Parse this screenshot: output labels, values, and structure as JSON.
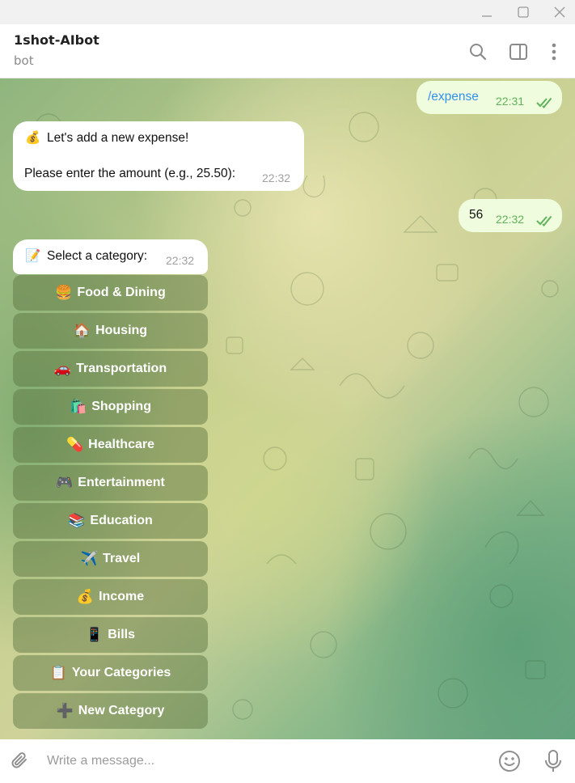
{
  "window": {
    "minimize_icon": "minimize-icon",
    "maximize_icon": "maximize-icon",
    "close_icon": "close-icon"
  },
  "header": {
    "title": "1shot-AIbot",
    "status": "bot",
    "icons": [
      "search-icon",
      "sidebar-toggle-icon",
      "more-vertical-icon"
    ]
  },
  "messages": [
    {
      "direction": "outgoing",
      "text": "/expense",
      "time": "22:31",
      "read": true
    },
    {
      "direction": "incoming",
      "line1_emoji": "💰",
      "line1": "Let's add a new expense!",
      "line2": "Please enter the amount (e.g., 25.50):",
      "time": "22:32"
    },
    {
      "direction": "outgoing",
      "text": "56",
      "time": "22:32",
      "read": true
    },
    {
      "direction": "incoming",
      "emoji": "📝",
      "text": "Select a category:",
      "time": "22:32"
    }
  ],
  "keyboard": [
    {
      "emoji": "🍔",
      "label": "Food & Dining"
    },
    {
      "emoji": "🏠",
      "label": "Housing"
    },
    {
      "emoji": "🚗",
      "label": "Transportation"
    },
    {
      "emoji": "🛍️",
      "label": "Shopping"
    },
    {
      "emoji": "💊",
      "label": "Healthcare"
    },
    {
      "emoji": "🎮",
      "label": "Entertainment"
    },
    {
      "emoji": "📚",
      "label": "Education"
    },
    {
      "emoji": "✈️",
      "label": "Travel"
    },
    {
      "emoji": "💰",
      "label": "Income"
    },
    {
      "emoji": "📱",
      "label": "Bills"
    },
    {
      "emoji": "📋",
      "label": "Your Categories"
    },
    {
      "emoji": "➕",
      "label": "New Category"
    }
  ],
  "composer": {
    "placeholder": "Write a message...",
    "icons": [
      "attach-icon",
      "emoji-icon",
      "microphone-icon"
    ]
  },
  "colors": {
    "outgoing_bubble": "#effdde",
    "incoming_bubble": "#ffffff",
    "link": "#3390ec",
    "time_outgoing": "#5fb35a",
    "keyboard_button": "#5c7640"
  }
}
